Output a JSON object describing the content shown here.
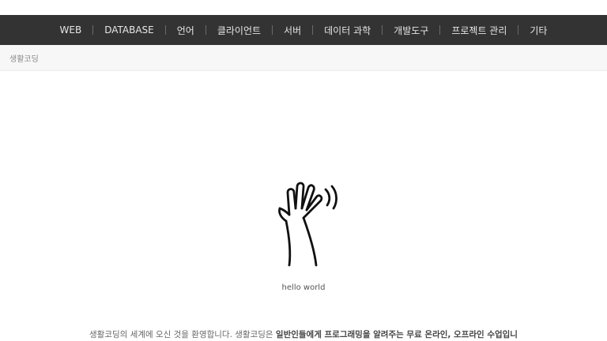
{
  "nav": {
    "items": [
      {
        "label": "WEB"
      },
      {
        "label": "DATABASE"
      },
      {
        "label": "언어"
      },
      {
        "label": "클라이언트"
      },
      {
        "label": "서버"
      },
      {
        "label": "데이터 과학"
      },
      {
        "label": "개발도구"
      },
      {
        "label": "프로젝트 관리"
      },
      {
        "label": "기타"
      }
    ]
  },
  "breadcrumb": {
    "label": "생활코딩"
  },
  "hero": {
    "icon": "waving-hand-icon",
    "caption": "hello world"
  },
  "welcome": {
    "text_plain": "생활코딩의 세계에 오신 것을 환영합니다. 생활코딩은 ",
    "text_strong": "일반인들에게 프로그래밍을 알려주는 무료 온라인, 오프라인 수업입니"
  },
  "colors": {
    "nav_background": "#333333",
    "nav_text": "#e6e6e6",
    "breadcrumb_background": "#f7f7f7"
  }
}
